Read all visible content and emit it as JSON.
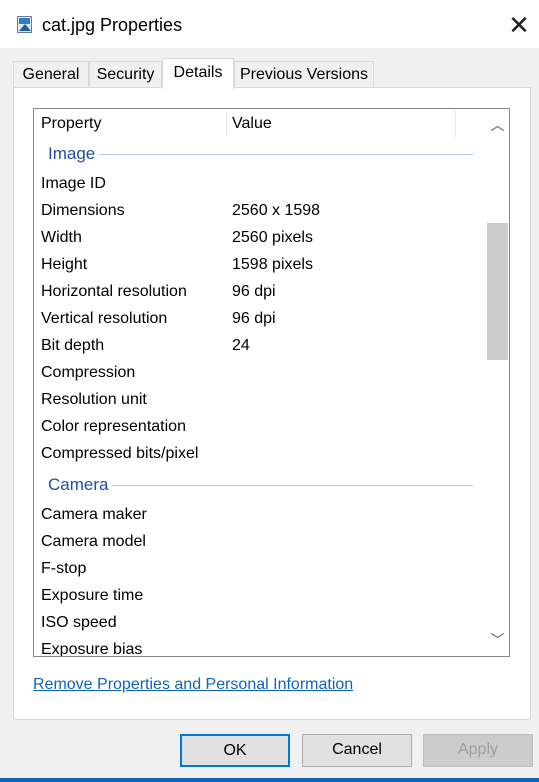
{
  "window": {
    "title": "cat.jpg Properties",
    "title_icon": "image-file-icon",
    "close_glyph": "✕"
  },
  "tabs": [
    {
      "label": "General",
      "active": false
    },
    {
      "label": "Security",
      "active": false
    },
    {
      "label": "Details",
      "active": true
    },
    {
      "label": "Previous Versions",
      "active": false
    }
  ],
  "list": {
    "headers": {
      "property": "Property",
      "value": "Value"
    },
    "groups": [
      {
        "name": "Image",
        "rows": [
          {
            "property": "Image ID",
            "value": ""
          },
          {
            "property": "Dimensions",
            "value": "2560 x 1598"
          },
          {
            "property": "Width",
            "value": "2560 pixels"
          },
          {
            "property": "Height",
            "value": "1598 pixels"
          },
          {
            "property": "Horizontal resolution",
            "value": "96 dpi"
          },
          {
            "property": "Vertical resolution",
            "value": "96 dpi"
          },
          {
            "property": "Bit depth",
            "value": "24"
          },
          {
            "property": "Compression",
            "value": ""
          },
          {
            "property": "Resolution unit",
            "value": ""
          },
          {
            "property": "Color representation",
            "value": ""
          },
          {
            "property": "Compressed bits/pixel",
            "value": ""
          }
        ]
      },
      {
        "name": "Camera",
        "rows": [
          {
            "property": "Camera maker",
            "value": ""
          },
          {
            "property": "Camera model",
            "value": ""
          },
          {
            "property": "F-stop",
            "value": ""
          },
          {
            "property": "Exposure time",
            "value": ""
          },
          {
            "property": "ISO speed",
            "value": ""
          },
          {
            "property": "Exposure bias",
            "value": ""
          }
        ]
      }
    ],
    "scroll_up_glyph": "︿",
    "scroll_down_glyph": "﹀"
  },
  "link_label": "Remove Properties and Personal Information",
  "buttons": {
    "ok": "OK",
    "cancel": "Cancel",
    "apply": "Apply"
  },
  "colors": {
    "accent": "#0078d7",
    "link": "#0f63bd",
    "group_header": "#1f4e9a"
  }
}
